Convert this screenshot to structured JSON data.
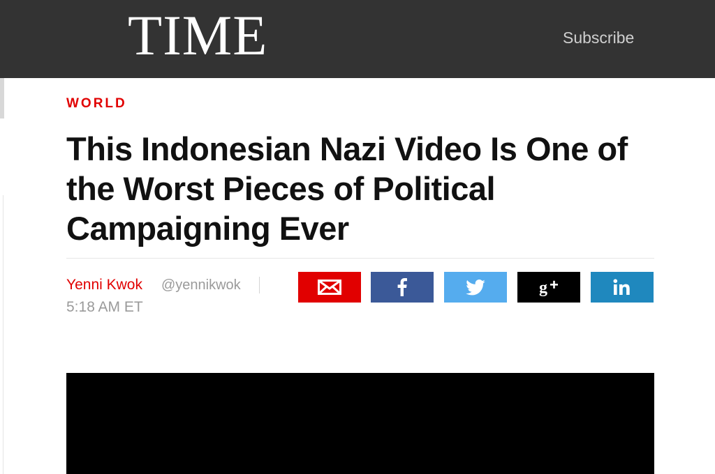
{
  "header": {
    "logo_text": "TIME",
    "subscribe_label": "Subscribe"
  },
  "article": {
    "section": "WORLD",
    "headline": "This Indonesian Nazi Video Is One of the Worst Pieces of Political Campaigning Ever",
    "author": "Yenni Kwok",
    "author_handle": "@yennikwok",
    "timestamp": "5:18 AM ET"
  },
  "share": {
    "buttons": [
      {
        "network": "email",
        "icon": "email-icon",
        "color": "#e10000"
      },
      {
        "network": "facebook",
        "icon": "facebook-icon",
        "color": "#3b5998"
      },
      {
        "network": "twitter",
        "icon": "twitter-icon",
        "color": "#55acee"
      },
      {
        "network": "google-plus",
        "icon": "google-plus-icon",
        "color": "#000000"
      },
      {
        "network": "linkedin",
        "icon": "linkedin-icon",
        "color": "#1f88be"
      }
    ]
  },
  "colors": {
    "header_bg": "#333333",
    "accent_red": "#e10000",
    "headline_text": "#111111",
    "meta_gray": "#9a9a9a"
  }
}
